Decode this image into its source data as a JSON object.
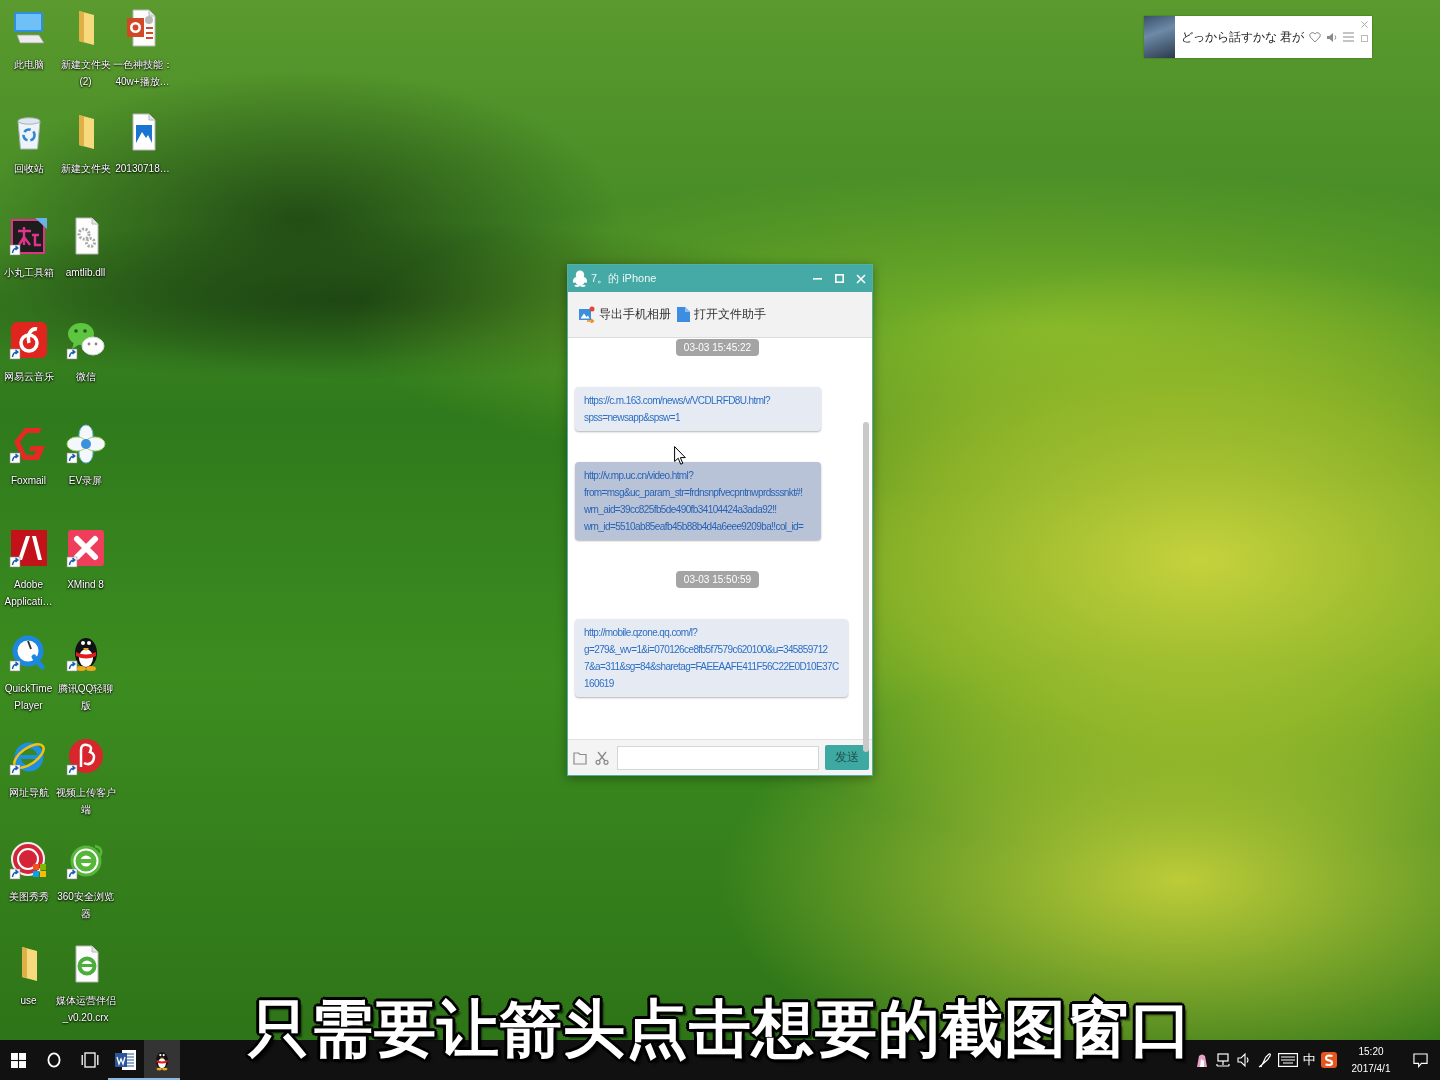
{
  "desktop": {
    "icons": [
      {
        "label": "此电脑",
        "kind": "computer",
        "shortcut": false
      },
      {
        "label": "回收站",
        "kind": "recyclebin",
        "shortcut": false
      },
      {
        "label": "小丸工具箱",
        "kind": "toolbox",
        "shortcut": true
      },
      {
        "label": "网易云音乐",
        "kind": "music",
        "shortcut": true
      },
      {
        "label": "Foxmail",
        "kind": "foxmail",
        "shortcut": true
      },
      {
        "label": "Adobe Applicati…",
        "kind": "adobe",
        "shortcut": true
      },
      {
        "label": "QuickTime Player",
        "kind": "quicktime",
        "shortcut": true
      },
      {
        "label": "网址导航",
        "kind": "ie",
        "shortcut": true
      },
      {
        "label": "美图秀秀",
        "kind": "meitu",
        "shortcut": true
      },
      {
        "label": "use",
        "kind": "folder",
        "shortcut": false
      },
      {
        "label": "新建文件夹 (2)",
        "kind": "folder",
        "shortcut": false
      },
      {
        "label": "新建文件夹",
        "kind": "folder",
        "shortcut": false
      },
      {
        "label": "amtlib.dll",
        "kind": "dll",
        "shortcut": false
      },
      {
        "label": "微信",
        "kind": "wechat",
        "shortcut": true
      },
      {
        "label": "EV录屏",
        "kind": "recorder",
        "shortcut": true
      },
      {
        "label": "XMind 8",
        "kind": "xmind",
        "shortcut": true
      },
      {
        "label": "腾讯QQ轻聊版",
        "kind": "penguin",
        "shortcut": true
      },
      {
        "label": "视频上传客户端",
        "kind": "uploader",
        "shortcut": true
      },
      {
        "label": "360安全浏览器",
        "kind": "browser",
        "shortcut": true
      },
      {
        "label": "媒体运营伴侣_v0.20.crx",
        "kind": "crx",
        "shortcut": false
      },
      {
        "label": "一色神技能：40w+播放…",
        "kind": "slides",
        "shortcut": false
      },
      {
        "label": "20130718…",
        "kind": "image",
        "shortcut": false
      }
    ]
  },
  "music_widget": {
    "lyric": "どっから話すかな 君が"
  },
  "chat_window": {
    "title": "7。的 iPhone",
    "toolbar": [
      {
        "kind": "photos",
        "label": "导出手机相册"
      },
      {
        "kind": "files",
        "label": "打开文件助手"
      }
    ],
    "messages": [
      {
        "kind": "timestamp",
        "text": "03-03 15:45:22"
      },
      {
        "kind": "link",
        "highlighted": false,
        "lines": [
          "https://c.m.163.com/news/v/VCDLRFD8U.html?",
          "spss=newsapp&spsw=1"
        ]
      },
      {
        "kind": "link",
        "highlighted": true,
        "lines": [
          "http://v.mp.uc.cn/video.html?",
          "from=msg&uc_param_str=frdnsnpfvecpntnwprdsssnkt#!",
          "wm_aid=39cc825fb5de490fb34104424a3ada92!!",
          "wm_id=5510ab85eafb45b88b4d4a6eee9209ba!!col_id="
        ]
      },
      {
        "kind": "timestamp",
        "text": "03-03 15:50:59"
      },
      {
        "kind": "link",
        "highlighted": false,
        "lines": [
          "http://mobile.qzone.qq.com/l?",
          "g=279&_wv=1&i=070126ce8fb5f7579c620100&u=345859712",
          "7&a=311&sg=84&sharetag=FAEEAAFE411F56C22E0D10E37C",
          "160619"
        ]
      }
    ],
    "send_button": "发送"
  },
  "caption": "只需要让箭头点击想要的截图窗口",
  "taskbar": {
    "apps": [
      {
        "kind": "word",
        "running": true,
        "selected": false
      },
      {
        "kind": "qq",
        "running": true,
        "selected": true
      }
    ],
    "tray": [
      {
        "kind": "app"
      },
      {
        "kind": "network"
      },
      {
        "kind": "volume"
      },
      {
        "kind": "pen"
      },
      {
        "kind": "keyboard"
      },
      {
        "kind": "ime",
        "text": "中"
      },
      {
        "kind": "sogou"
      }
    ],
    "clock": {
      "time": "15:20",
      "date": "2017/4/1"
    }
  }
}
